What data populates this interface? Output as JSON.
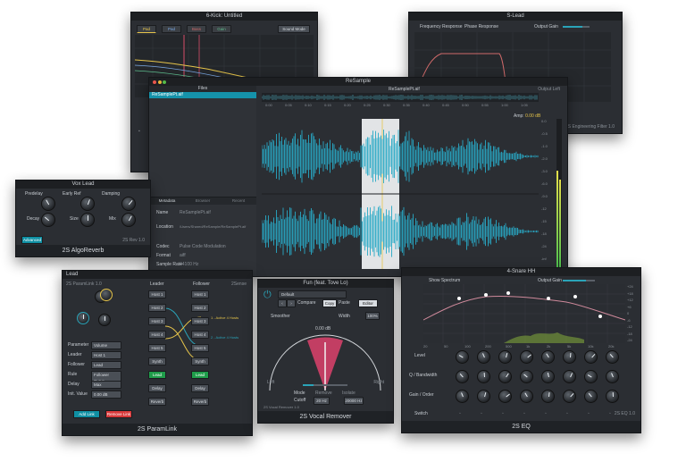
{
  "kick": {
    "title": "6-Kick: Untitled",
    "tabs": [
      "Pad",
      "Pad",
      "Bass",
      "Gain"
    ],
    "reset_label": "Sound Mode"
  },
  "s_lead": {
    "title": "S-Lead",
    "tabs": [
      "Frequency Response",
      "Phase Response"
    ],
    "gain_label": "Output Gain",
    "footer": "2S Engineering Filter 1.0"
  },
  "sample": {
    "title": "ReSample",
    "file_tab": "Files",
    "file_name": "ReSamplePt.aif",
    "header_name": "ReSamplePt.aif",
    "meter_label": "Output Left",
    "amp_label": "Amp",
    "amp_value": "0.00 dB",
    "time_ticks": [
      "0:00",
      "0:05",
      "0:10",
      "0:15",
      "0:20",
      "0:25",
      "0:30",
      "0:35",
      "0:40",
      "0:45",
      "0:50",
      "0:55",
      "1:00",
      "1:05"
    ],
    "db_ticks": [
      "0.0",
      "-0.5",
      "-1.0",
      "-2.0",
      "-3.0",
      "-6.0",
      "-9.0",
      "-12",
      "-15",
      "-18",
      "-24",
      "-inf"
    ],
    "info_tabs": [
      "Metadata",
      "Browser",
      "Recent"
    ],
    "info": [
      {
        "key": "Name",
        "value": "ReSamplePt.aif"
      },
      {
        "key": "Location",
        "value": "/Users/Shared/ReSample/ReSamplePt.aif"
      },
      {
        "key": "Codec",
        "value": "Pulse Code Modulation"
      },
      {
        "key": "Format",
        "value": "aiff"
      },
      {
        "key": "Sample Rate",
        "value": "44100 Hz"
      }
    ]
  },
  "reverb": {
    "title": "Vox Lead",
    "knobs": [
      "Predelay",
      "Early Ref",
      "Damping",
      "Decay",
      "Size",
      "Mix"
    ],
    "button": "Advanced",
    "footer": "2S AlgoReverb",
    "version": "2S Rev 1.0"
  },
  "paramlink": {
    "title": "Lead",
    "header_left": "2S ParamLink 1.0",
    "rows": [
      {
        "label": "Parameter",
        "value": "Volume"
      },
      {
        "label": "Leader",
        "value": "Host 1"
      },
      {
        "label": "Follower",
        "value": "Lead"
      },
      {
        "label": "Rule",
        "value": "Follower Curve"
      },
      {
        "label": "Delay",
        "value": "Max"
      },
      {
        "label": "Init. Value",
        "value": "0.00 dB"
      }
    ],
    "col_leader": "Leader",
    "col_follower": "Follower",
    "leader_items": [
      "Host 1",
      "Host 2",
      "Host 3",
      "Host 4",
      "Host 5",
      "Synth",
      "Lead",
      "Delay",
      "Reverb"
    ],
    "follower_items": [
      "Host 1",
      "Host 2",
      "Host 3",
      "Host 4",
      "Host 5",
      "Synth",
      "Lead",
      "Delay",
      "Reverb"
    ],
    "link_notes": [
      "1 - Active 4 Hosts",
      "2 - Active 4 Hosts"
    ],
    "add_label": "Add Link",
    "remove_label": "Remove Link",
    "footer": "2S ParamLink",
    "brand": "2Sense"
  },
  "vocal": {
    "title": "Fun (feat. Tove Lo)",
    "preset": "Default",
    "compare": "Compare",
    "copy": "Copy",
    "paste": "Paste",
    "editor": "Editor",
    "smooth_label": "Smoother",
    "width_label": "Width",
    "width_value": "100%",
    "left": "Left",
    "right": "Right",
    "center_value": "0.00 dB",
    "mode_label": "Mode",
    "mode_values": [
      "Remove",
      "Isolate"
    ],
    "cutoff_label": "Cutoff",
    "cutoff_low": "20 Hz",
    "cutoff_high": "20000 Hz",
    "footer": "2S Vocal Remover",
    "version": "2S Vocal Remover 1.0"
  },
  "eq": {
    "title": "4-Snare HH",
    "spectrum_label": "Show Spectrum",
    "gain_label": "Output Gain",
    "freq_ticks": [
      "20",
      "50",
      "100",
      "200",
      "500",
      "1k",
      "2k",
      "5k",
      "10k",
      "20k"
    ],
    "db_ticks": [
      "+24",
      "+18",
      "+12",
      "+6",
      "0",
      "-6",
      "-12",
      "-18",
      "-24"
    ],
    "rows": [
      "Level",
      "Q / Bandwidth",
      "Gain / Order"
    ],
    "switch_label": "Switch",
    "footer": "2S EQ",
    "version": "2S EQ 1.0"
  }
}
